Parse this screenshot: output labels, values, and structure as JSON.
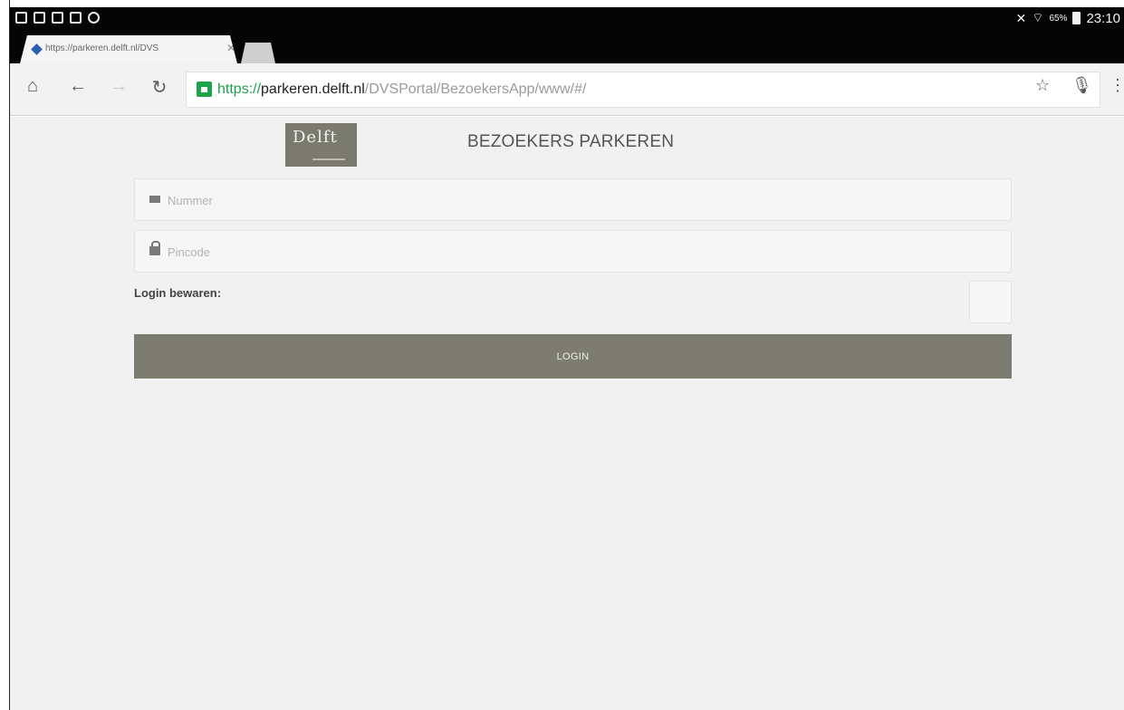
{
  "status_bar": {
    "battery_percent": "65%",
    "time": "23:10",
    "left_icons": [
      "window-icon",
      "notification-icon",
      "notification-icon",
      "calendar-icon",
      "cloud-icon"
    ]
  },
  "tab": {
    "title": "https://parkeren.delft.nl/DVS"
  },
  "toolbar": {
    "url_scheme": "https://",
    "url_host": "parkeren.delft.nl",
    "url_path": "/DVSPortal/BezoekersApp/www/#/"
  },
  "page": {
    "logo_text": "Delft",
    "title": "BEZOEKERS PARKEREN",
    "nummer_placeholder": "Nummer",
    "pincode_placeholder": "Pincode",
    "remember_label": "Login bewaren:",
    "login_label": "LOGIN"
  },
  "colors": {
    "accent": "#7c7c70",
    "background": "#f1f1f1",
    "secure": "#1ea24a"
  }
}
